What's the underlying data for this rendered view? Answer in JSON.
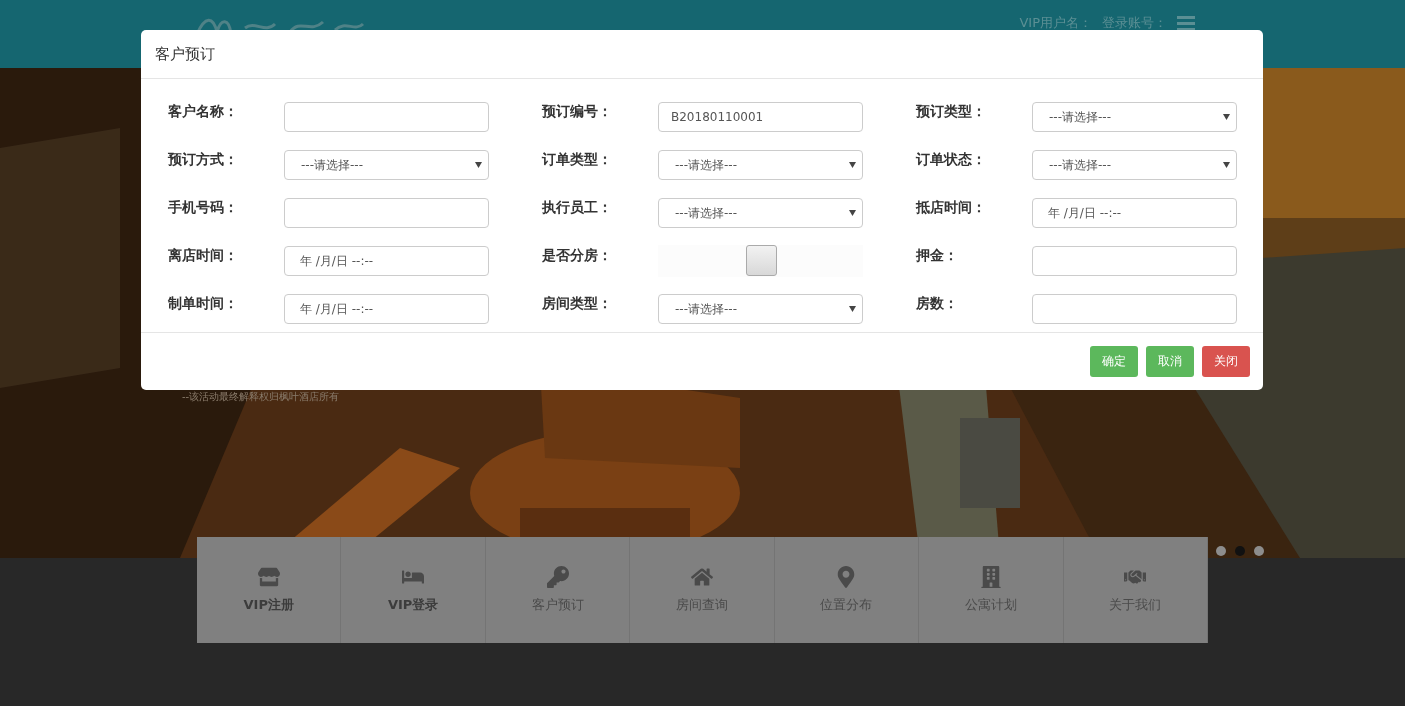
{
  "header": {
    "user_label": "VIP用户名：",
    "account_label": "登录账号："
  },
  "hero": {
    "kind": "picture",
    "caption": "--该活动最终解释权归枫叶酒店所有",
    "dots": [
      {
        "selected": false
      },
      {
        "selected": true
      },
      {
        "selected": false
      }
    ]
  },
  "dialog": {
    "title": "客户预订",
    "fields": [
      {
        "label": "客户名称：",
        "kind": "text"
      },
      {
        "label": "预订编号：",
        "kind": "text",
        "value": "B20180110001"
      },
      {
        "label": "预订类型：",
        "kind": "select",
        "placeholder": "---请选择---"
      },
      {
        "label": "预订方式：",
        "kind": "select",
        "placeholder": "---请选择---"
      },
      {
        "label": "订单类型：",
        "kind": "select",
        "placeholder": "---请选择---"
      },
      {
        "label": "订单状态：",
        "kind": "select",
        "placeholder": "---请选择---"
      },
      {
        "label": "手机号码：",
        "kind": "text"
      },
      {
        "label": "执行员工：",
        "kind": "select",
        "placeholder": "---请选择---"
      },
      {
        "label": "抵店时间：",
        "kind": "datetime",
        "value": "年 /月/日 --:--"
      },
      {
        "label": "离店时间：",
        "kind": "datetime",
        "value": "年 /月/日 --:--"
      },
      {
        "label": "是否分房：",
        "kind": "switch",
        "level": 0.5
      },
      {
        "label": "押金：",
        "kind": "text"
      },
      {
        "label": "制单时间：",
        "kind": "datetime",
        "value": "年 /月/日 --:--"
      },
      {
        "label": "房间类型：",
        "kind": "select",
        "placeholder": "---请选择---"
      },
      {
        "label": "房数：",
        "kind": "text"
      }
    ],
    "buttons": [
      {
        "label": "确定",
        "kind": "success"
      },
      {
        "label": "取消",
        "kind": "success"
      },
      {
        "label": "关闭",
        "kind": "danger"
      }
    ]
  },
  "nav": [
    {
      "label": "VIP注册",
      "bold": true
    },
    {
      "label": "VIP登录",
      "bold": true
    },
    {
      "label": "客户预订",
      "bold": false
    },
    {
      "label": "房间查询",
      "bold": false
    },
    {
      "label": "位置分布",
      "bold": false
    },
    {
      "label": "公寓计划",
      "bold": false
    },
    {
      "label": "关于我们",
      "bold": false
    }
  ]
}
